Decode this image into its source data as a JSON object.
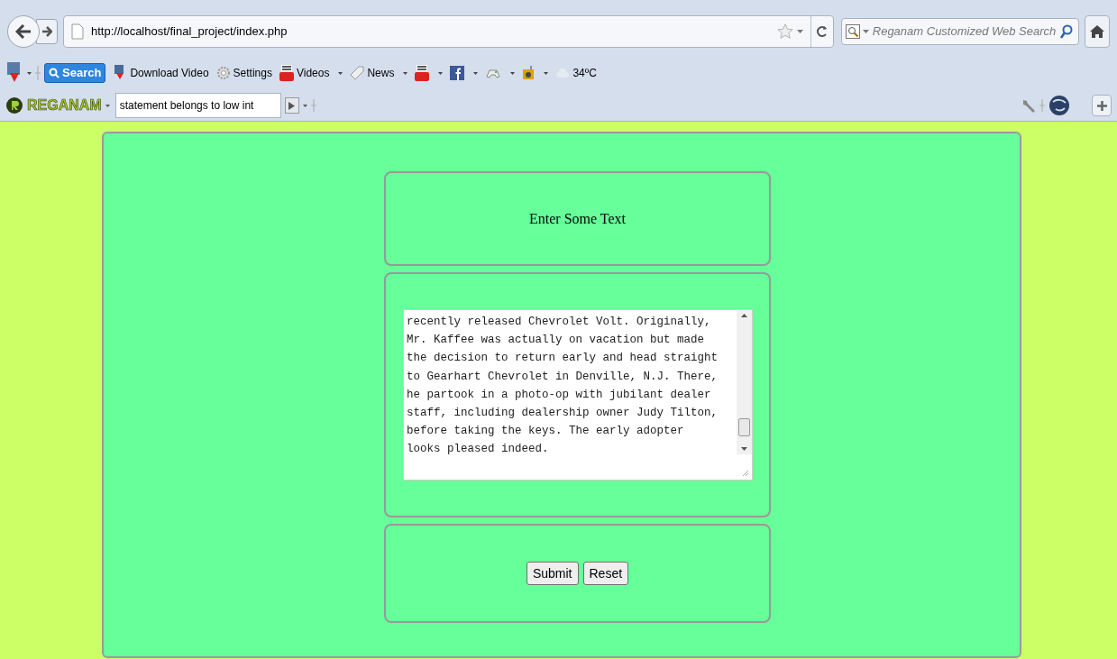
{
  "browser": {
    "url": "http://localhost/final_project/index.php",
    "search_placeholder": "Reganam Customized Web Search"
  },
  "toolbar": {
    "search_button": "Search",
    "items": [
      {
        "kind": "download",
        "label": "Download Video",
        "dropdown": false
      },
      {
        "kind": "gear",
        "label": "Settings",
        "dropdown": false
      },
      {
        "kind": "youtube",
        "label": "Videos",
        "dropdown": true
      },
      {
        "kind": "tag",
        "label": "News",
        "dropdown": true
      },
      {
        "kind": "youtube",
        "dropdown": true
      },
      {
        "kind": "facebook",
        "dropdown": true
      },
      {
        "kind": "gamepad",
        "dropdown": true
      },
      {
        "kind": "radio",
        "dropdown": true
      },
      {
        "kind": "cloud",
        "label": "34ºC",
        "dropdown": false
      }
    ]
  },
  "reganam_bar": {
    "logo": "REGANAM",
    "search_value": "statement belongs to low int"
  },
  "form": {
    "heading": "Enter Some Text",
    "text_lines": [
      "recently released Chevrolet Volt. Originally,",
      "Mr. Kaffee was actually on vacation but made",
      "the decision to return early and head straight",
      "to Gearhart Chevrolet in Denville, N.J. There,",
      "he partook in a photo-op with jubilant dealer",
      "staff, including dealership owner Judy Tilton,",
      "before taking the keys. The early adopter",
      "looks pleased indeed."
    ],
    "buttons": [
      "Submit",
      "Reset"
    ]
  }
}
